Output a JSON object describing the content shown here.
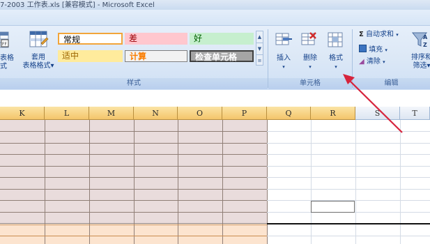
{
  "window": {
    "title": "7-2003 工作表.xls  [兼容模式] - Microsoft Excel"
  },
  "styles_group": {
    "table_format_left_label": "表格式",
    "cell_styles_btn": [
      "套用",
      "表格格式"
    ],
    "cells": [
      {
        "text": "常规",
        "bg": "#ffffff",
        "color": "#000000"
      },
      {
        "text": "差",
        "bg": "#ffc7ce",
        "color": "#9c0006"
      },
      {
        "text": "好",
        "bg": "#c6efce",
        "color": "#006100"
      },
      {
        "text": "适中",
        "bg": "#ffeb9c",
        "color": "#9c6500"
      },
      {
        "text": "计算",
        "bg": "#f2f2f2",
        "color": "#fa7d00"
      },
      {
        "text": "检查单元格",
        "bg": "#a5a5a5",
        "color": "#ffffff"
      }
    ],
    "label": "样式"
  },
  "cells_group": {
    "insert": "插入",
    "delete": "删除",
    "format": "格式",
    "label": "单元格"
  },
  "editing_group": {
    "autosum": "自动求和",
    "fill": "填充",
    "clear": "清除",
    "sort_filter": [
      "排序和",
      "筛选"
    ],
    "label": "编辑"
  },
  "columns": [
    "K",
    "L",
    "M",
    "N",
    "O",
    "P",
    "Q",
    "R",
    "S",
    "T"
  ],
  "colors": {
    "accent_arrow": "#d6243c",
    "formatted_header": "#f6c66f",
    "pink_fill": "#e9dcdc",
    "peach_fill": "#fce4cf"
  }
}
